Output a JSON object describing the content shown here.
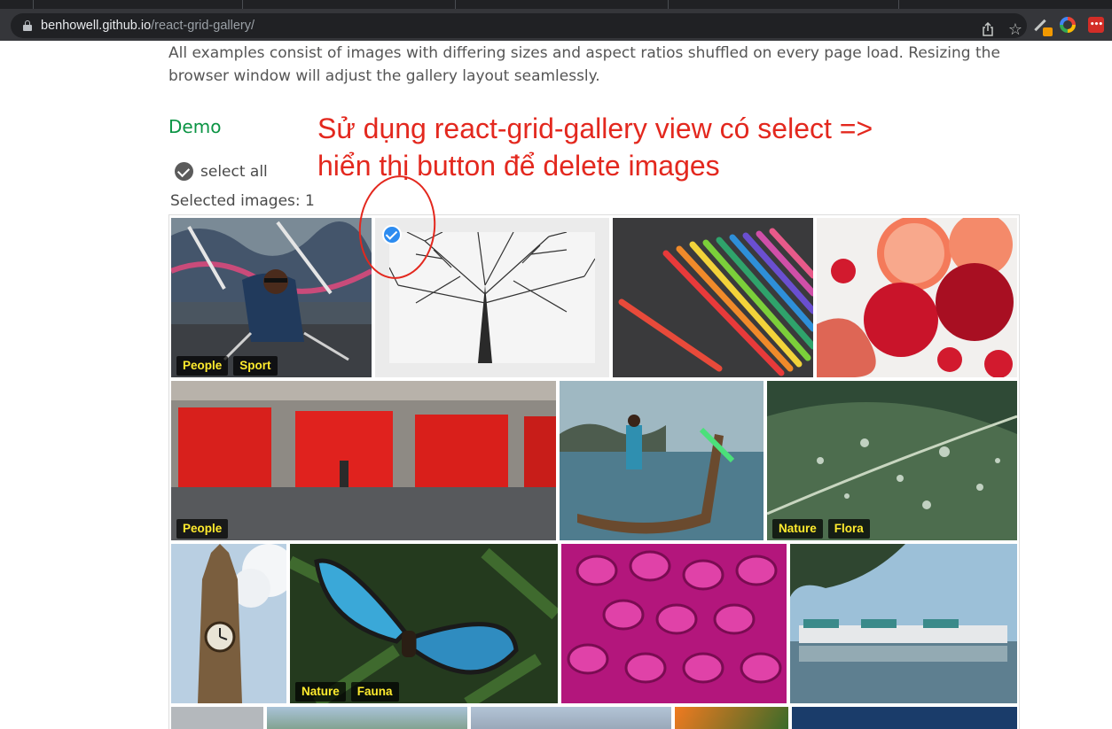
{
  "browser": {
    "url_host": "benhowell.github.io",
    "url_path": "/react-grid-gallery/",
    "icons": [
      "lock-icon",
      "share-icon",
      "star-icon",
      "pen-extension-icon",
      "color-ring-extension-icon",
      "lastpass-icon"
    ],
    "lastpass_label": "•••"
  },
  "page": {
    "intro": "All examples consist of images with differing sizes and aspect ratios shuffled on every page load. Resizing the browser window will adjust the gallery layout seamlessly.",
    "demo_heading": "Demo",
    "select_all_label": "select all",
    "selected_count": "Selected images: 1"
  },
  "annotation": {
    "text": "Sử dụng react-grid-gallery view có select =>\nhiển thị button để delete images",
    "color": "#e3281e"
  },
  "gallery": {
    "images": [
      {
        "name": "cyclist",
        "tags": [
          "People",
          "Sport"
        ],
        "selected": false
      },
      {
        "name": "bare-tree",
        "tags": [],
        "selected": true
      },
      {
        "name": "colored-pencils",
        "tags": [],
        "selected": false
      },
      {
        "name": "fruits",
        "tags": [],
        "selected": false
      },
      {
        "name": "red-doors",
        "tags": [
          "People"
        ],
        "selected": false
      },
      {
        "name": "longtail-boat",
        "tags": [],
        "selected": false
      },
      {
        "name": "leaf-droplets",
        "tags": [
          "Nature",
          "Flora"
        ],
        "selected": false
      },
      {
        "name": "clock-tower",
        "tags": [],
        "selected": false
      },
      {
        "name": "butterfly",
        "tags": [
          "Nature",
          "Fauna"
        ],
        "selected": false
      },
      {
        "name": "pink-dahlia",
        "tags": [],
        "selected": false
      },
      {
        "name": "harbor-boats",
        "tags": [],
        "selected": false
      }
    ]
  },
  "colors": {
    "demo_heading": "#0b9444",
    "tag_text": "#ffeb2e",
    "check_badge": "#2d8cf0"
  }
}
